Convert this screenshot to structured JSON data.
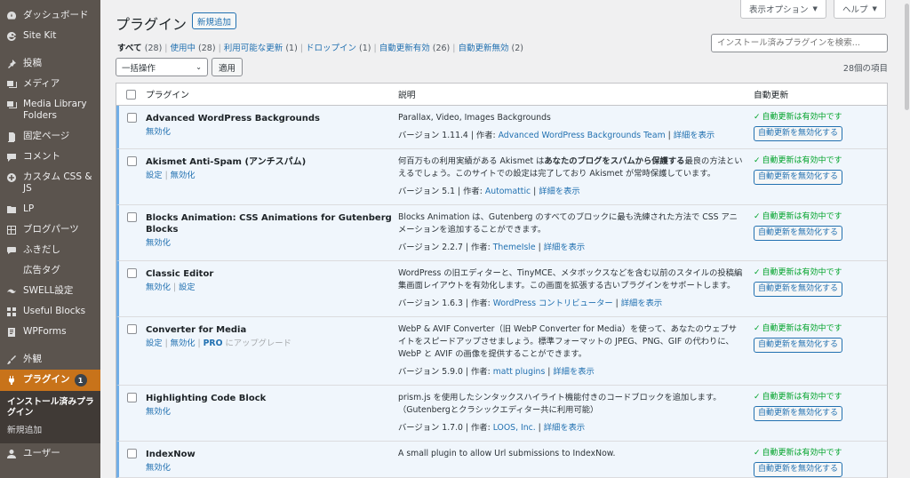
{
  "sidebar": {
    "items": [
      {
        "label": "ダッシュボード",
        "icon": "dashboard-icon"
      },
      {
        "label": "Site Kit",
        "icon": "google-g-icon"
      },
      {
        "label": "投稿",
        "icon": "pin-icon"
      },
      {
        "label": "メディア",
        "icon": "media-icon"
      },
      {
        "label": "Media Library Folders",
        "icon": "media-icon"
      },
      {
        "label": "固定ページ",
        "icon": "page-icon"
      },
      {
        "label": "コメント",
        "icon": "comment-icon"
      },
      {
        "label": "カスタム CSS & JS",
        "icon": "plus-circle-icon"
      },
      {
        "label": "LP",
        "icon": "folder-icon"
      },
      {
        "label": "ブログパーツ",
        "icon": "grid-icon"
      },
      {
        "label": "ふきだし",
        "icon": "speech-bubble-icon"
      },
      {
        "label": "広告タグ",
        "icon": ""
      },
      {
        "label": "SWELL設定",
        "icon": "swell-icon"
      },
      {
        "label": "Useful Blocks",
        "icon": "blocks-icon"
      },
      {
        "label": "WPForms",
        "icon": "form-icon"
      },
      {
        "label": "外観",
        "icon": "brush-icon"
      },
      {
        "label": "プラグイン",
        "icon": "plugin-icon",
        "badge": "1"
      },
      {
        "label": "ユーザー",
        "icon": "user-icon"
      }
    ],
    "submenu": [
      {
        "label": "インストール済みプラグイン"
      },
      {
        "label": "新規追加"
      }
    ]
  },
  "header": {
    "screen_options": "表示オプション",
    "help": "ヘルプ",
    "title": "プラグイン",
    "add_new": "新規追加"
  },
  "filters": [
    {
      "label": "すべて",
      "count": "(28)",
      "current": true
    },
    {
      "label": "使用中",
      "count": "(28)"
    },
    {
      "label": "利用可能な更新",
      "count": "(1)"
    },
    {
      "label": "ドロップイン",
      "count": "(1)"
    },
    {
      "label": "自動更新有効",
      "count": "(26)"
    },
    {
      "label": "自動更新無効",
      "count": "(2)"
    }
  ],
  "search": {
    "placeholder": "インストール済みプラグインを検索..."
  },
  "bulk": {
    "label": "一括操作",
    "apply": "適用"
  },
  "item_count": "28個の項目",
  "columns": {
    "name": "プラグイン",
    "desc": "説明",
    "auto": "自動更新"
  },
  "common": {
    "version_prefix": "バージョン",
    "author_prefix": "作者:",
    "details": "詳細を表示",
    "auto_status": "自動更新は有効中です",
    "auto_button": "自動更新を無効化する"
  },
  "plugins": [
    {
      "name": "Advanced WordPress Backgrounds",
      "actions": [
        {
          "label": "無効化"
        }
      ],
      "desc": [
        {
          "t": "Parallax, Video, Images Backgrounds"
        }
      ],
      "version": "1.11.4",
      "author": "Advanced WordPress Backgrounds Team"
    },
    {
      "name": "Akismet Anti-Spam (アンチスパム)",
      "actions": [
        {
          "label": "設定"
        },
        {
          "label": "無効化"
        }
      ],
      "desc": [
        {
          "t": "何百万もの利用実績がある Akismet は"
        },
        {
          "t": "あなたのブログをスパムから保護する",
          "b": true
        },
        {
          "t": "最良の方法といえるでしょう。このサイトでの設定は完了しており Akismet が常時保護しています。"
        }
      ],
      "version": "5.1",
      "author": "Automattic"
    },
    {
      "name": "Blocks Animation: CSS Animations for Gutenberg Blocks",
      "actions": [
        {
          "label": "無効化"
        }
      ],
      "desc": [
        {
          "t": "Blocks Animation は、Gutenberg のすべてのブロックに最も洗練された方法で CSS アニメーションを追加することができます。"
        }
      ],
      "version": "2.2.7",
      "author": "ThemeIsle"
    },
    {
      "name": "Classic Editor",
      "actions": [
        {
          "label": "無効化"
        },
        {
          "label": "設定"
        }
      ],
      "desc": [
        {
          "t": "WordPress の旧エディターと、TinyMCE、メタボックスなどを含む以前のスタイルの投稿編集画面レイアウトを有効化します。この画面を拡張する古いプラグインをサポートします。"
        }
      ],
      "version": "1.6.3",
      "author": "WordPress コントリビューター"
    },
    {
      "name": "Converter for Media",
      "actions": [
        {
          "label": "設定"
        },
        {
          "label": "無効化"
        },
        {
          "label": "PRO",
          "pro": true,
          "suffix": "にアップグレード"
        }
      ],
      "desc": [
        {
          "t": "WebP & AVIF Converter（旧 WebP Converter for Media）を使って、あなたのウェブサイトをスピードアップさせましょう。標準フォーマットの JPEG、PNG、GIF の代わりに、WebP と AVIF の画像を提供することができます。"
        }
      ],
      "version": "5.9.0",
      "author": "matt plugins"
    },
    {
      "name": "Highlighting Code Block",
      "actions": [
        {
          "label": "無効化"
        }
      ],
      "desc": [
        {
          "t": "prism.js を使用したシンタックスハイライト機能付きのコードブロックを追加します。（Gutenbergとクラシックエディター共に利用可能）"
        }
      ],
      "version": "1.7.0",
      "author": "LOOS, Inc."
    },
    {
      "name": "IndexNow",
      "actions": [
        {
          "label": "無効化"
        }
      ],
      "desc": [
        {
          "t": "A small plugin to allow Url submissions to IndexNow."
        }
      ],
      "version": "",
      "author": ""
    }
  ]
}
